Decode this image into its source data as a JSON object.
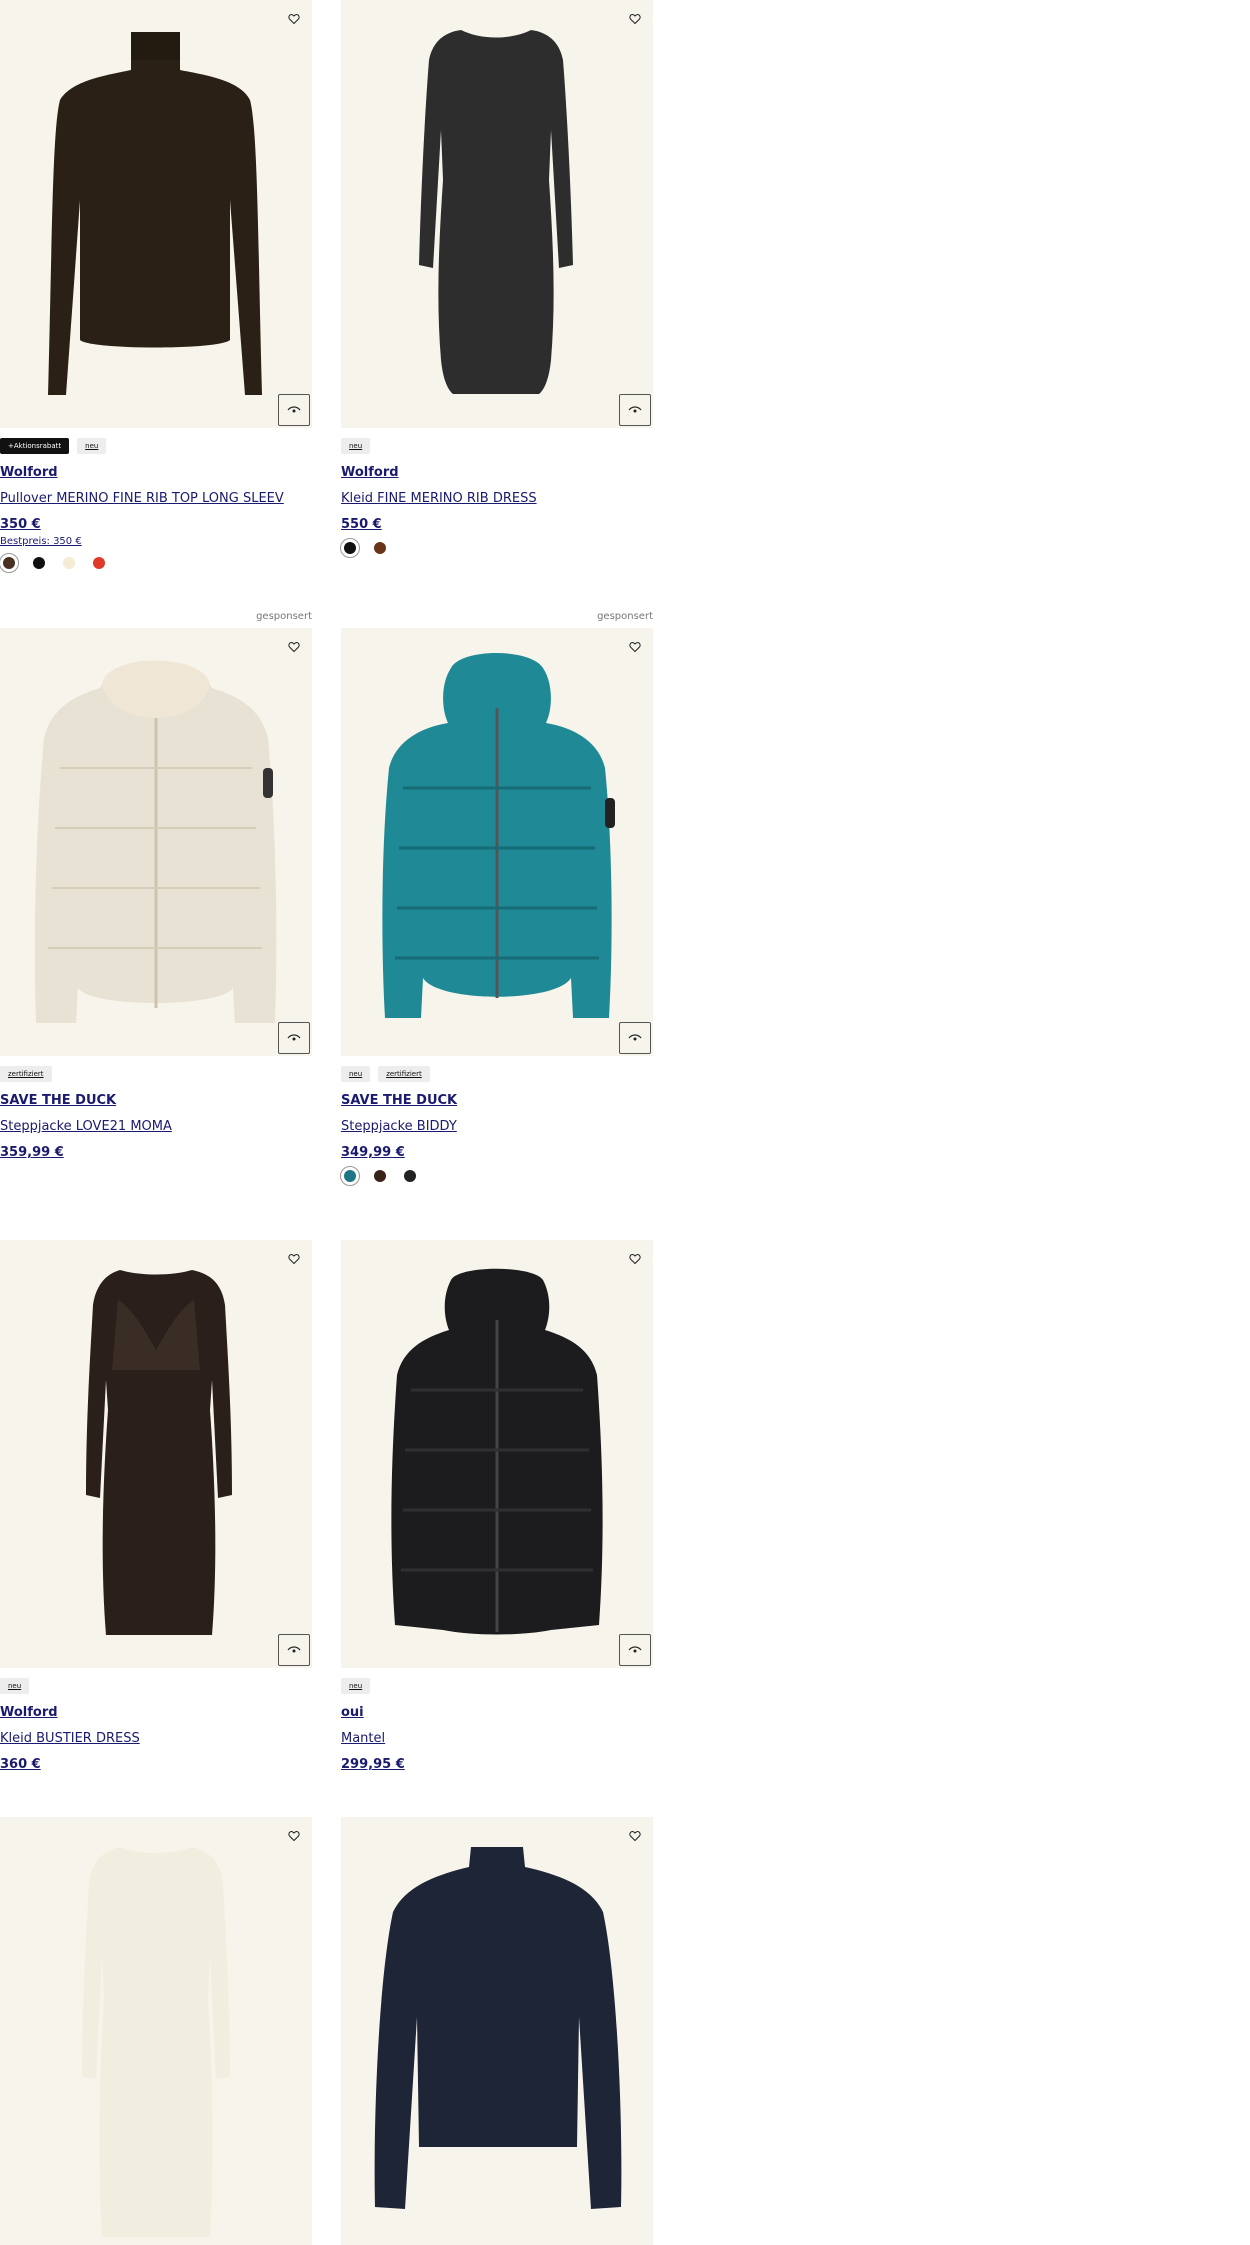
{
  "wishlist_icon": "heart-icon",
  "quickview_icon": "eye-icon",
  "sponsored_label": "gesponsert",
  "products": [
    {
      "badges": [
        "+Aktionsrabatt",
        "neu"
      ],
      "brand": "Wolford",
      "name": "Pullover MERINO FINE RIB TOP LONG SLEEV",
      "price": "350 €",
      "bestpreis": "Bestpreis: 350 €",
      "swatches": [
        "#4a3020",
        "#111111",
        "#f4ecd4",
        "#e0392a"
      ]
    },
    {
      "badges": [
        "neu"
      ],
      "brand": "Wolford",
      "name": "Kleid FINE MERINO RIB DRESS",
      "price": "550 €",
      "swatches": [
        "#111111",
        "#6a3418"
      ]
    },
    {
      "badges": [
        "zertifiziert"
      ],
      "brand": "SAVE THE DUCK",
      "name": "Steppjacke LOVE21 MOMA",
      "price": "359,99 €"
    },
    {
      "badges": [
        "neu",
        "zertifiziert"
      ],
      "brand": "SAVE THE DUCK",
      "name": "Steppjacke BIDDY",
      "price": "349,99 €",
      "swatches": [
        "#1e7585",
        "#3b2218",
        "#222222"
      ]
    },
    {
      "badges": [
        "neu"
      ],
      "brand": "Wolford",
      "name": "Kleid BUSTIER DRESS",
      "price": "360 €"
    },
    {
      "badges": [
        "neu"
      ],
      "brand": "oui",
      "name": "Mantel",
      "price": "299,95 €"
    },
    {},
    {}
  ]
}
